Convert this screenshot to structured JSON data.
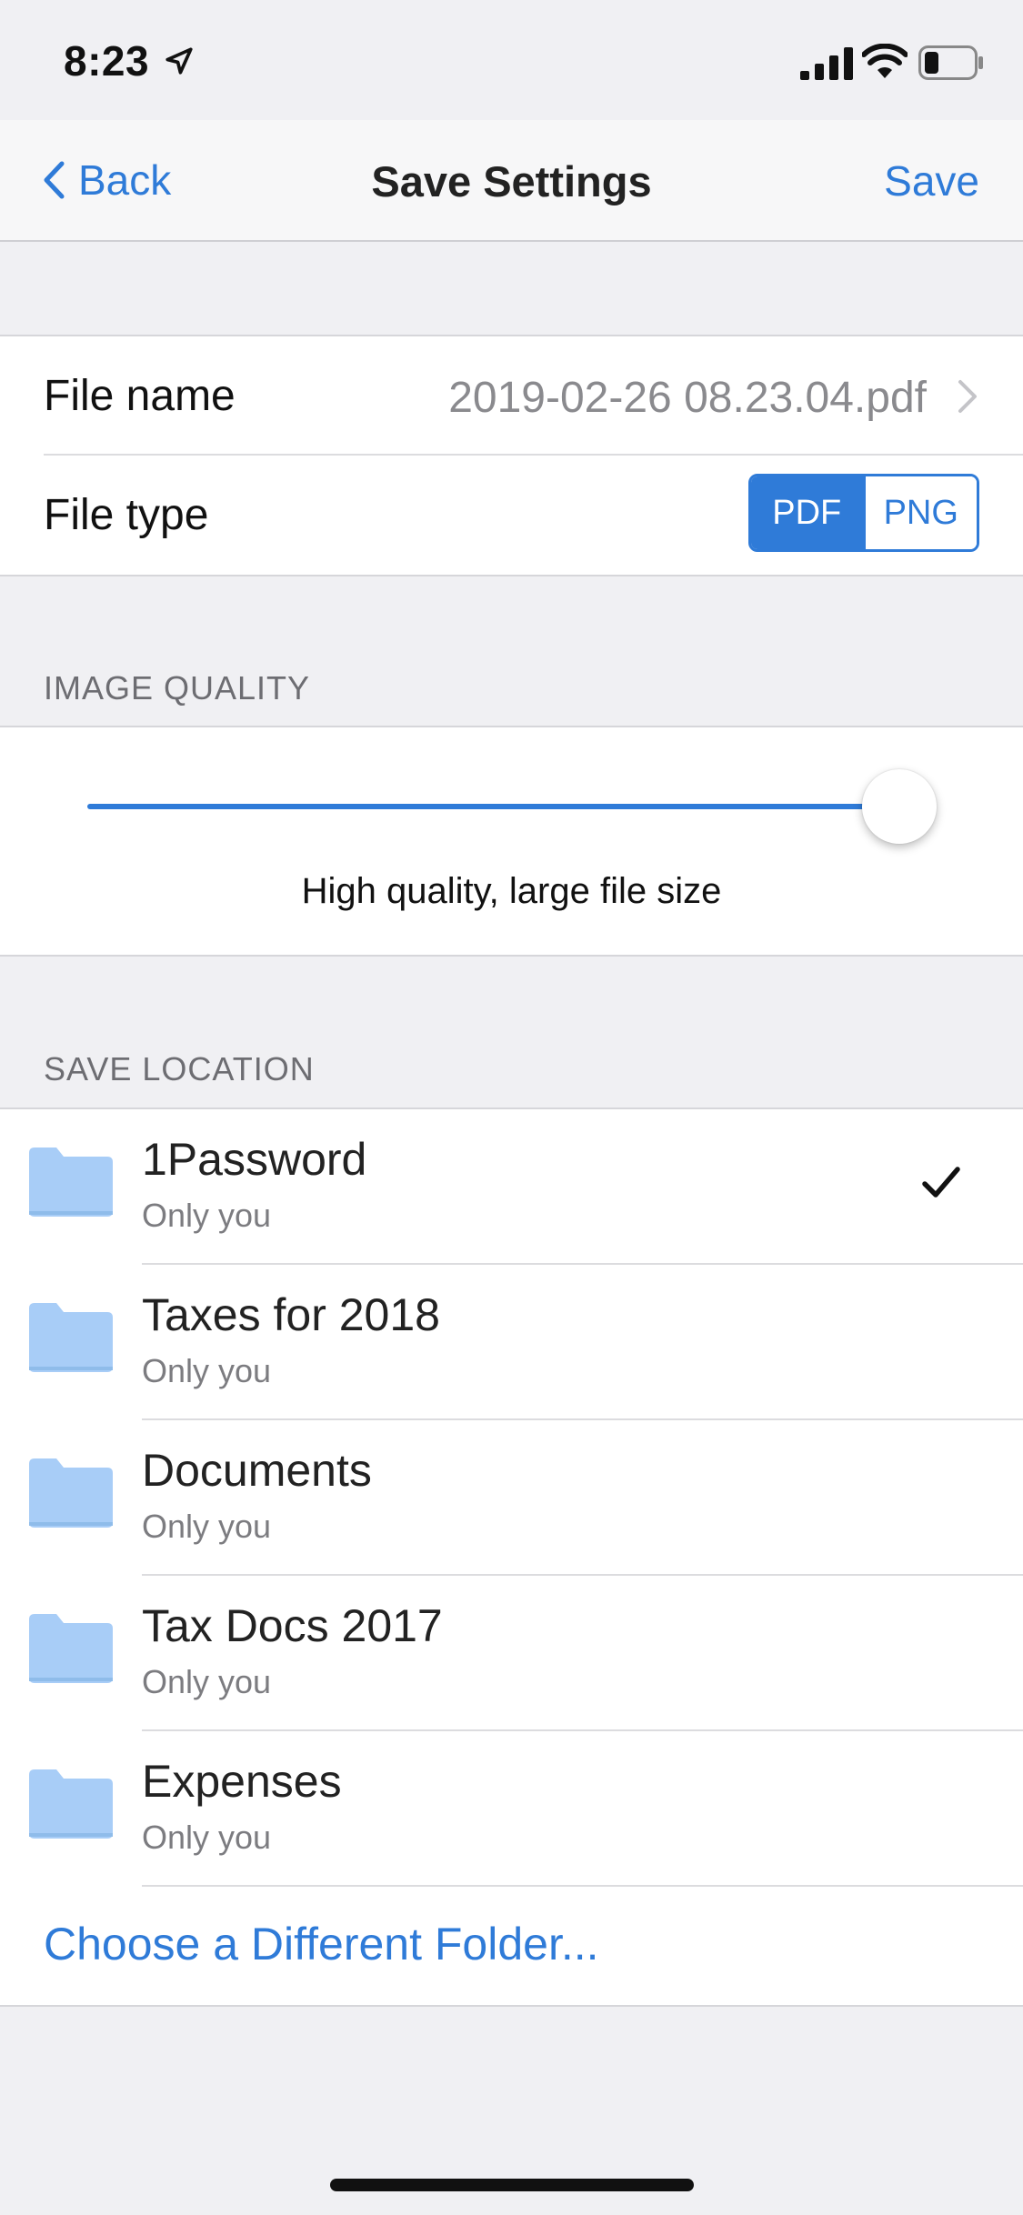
{
  "status_bar": {
    "time": "8:23",
    "icons": [
      "location-arrow-icon",
      "cellular-signal-icon",
      "wifi-icon",
      "battery-icon"
    ]
  },
  "nav": {
    "back_label": "Back",
    "title": "Save Settings",
    "save_label": "Save"
  },
  "file": {
    "name_label": "File name",
    "name_value": "2019-02-26 08.23.04.pdf",
    "type_label": "File type",
    "types": [
      {
        "label": "PDF",
        "selected": true
      },
      {
        "label": "PNG",
        "selected": false
      }
    ]
  },
  "image_quality": {
    "header": "IMAGE QUALITY",
    "level": 1.0,
    "caption": "High quality, large file size"
  },
  "save_location": {
    "header": "SAVE LOCATION",
    "folders": [
      {
        "name": "1Password",
        "sub": "Only you",
        "selected": true
      },
      {
        "name": "Taxes for 2018",
        "sub": "Only you",
        "selected": false
      },
      {
        "name": "Documents",
        "sub": "Only you",
        "selected": false
      },
      {
        "name": "Tax Docs 2017",
        "sub": "Only you",
        "selected": false
      },
      {
        "name": "Expenses",
        "sub": "Only you",
        "selected": false
      }
    ],
    "choose_label": "Choose a Different Folder..."
  },
  "colors": {
    "accent": "#2f7bd8",
    "folder": "#a8cdf7",
    "background": "#f0f0f3"
  }
}
